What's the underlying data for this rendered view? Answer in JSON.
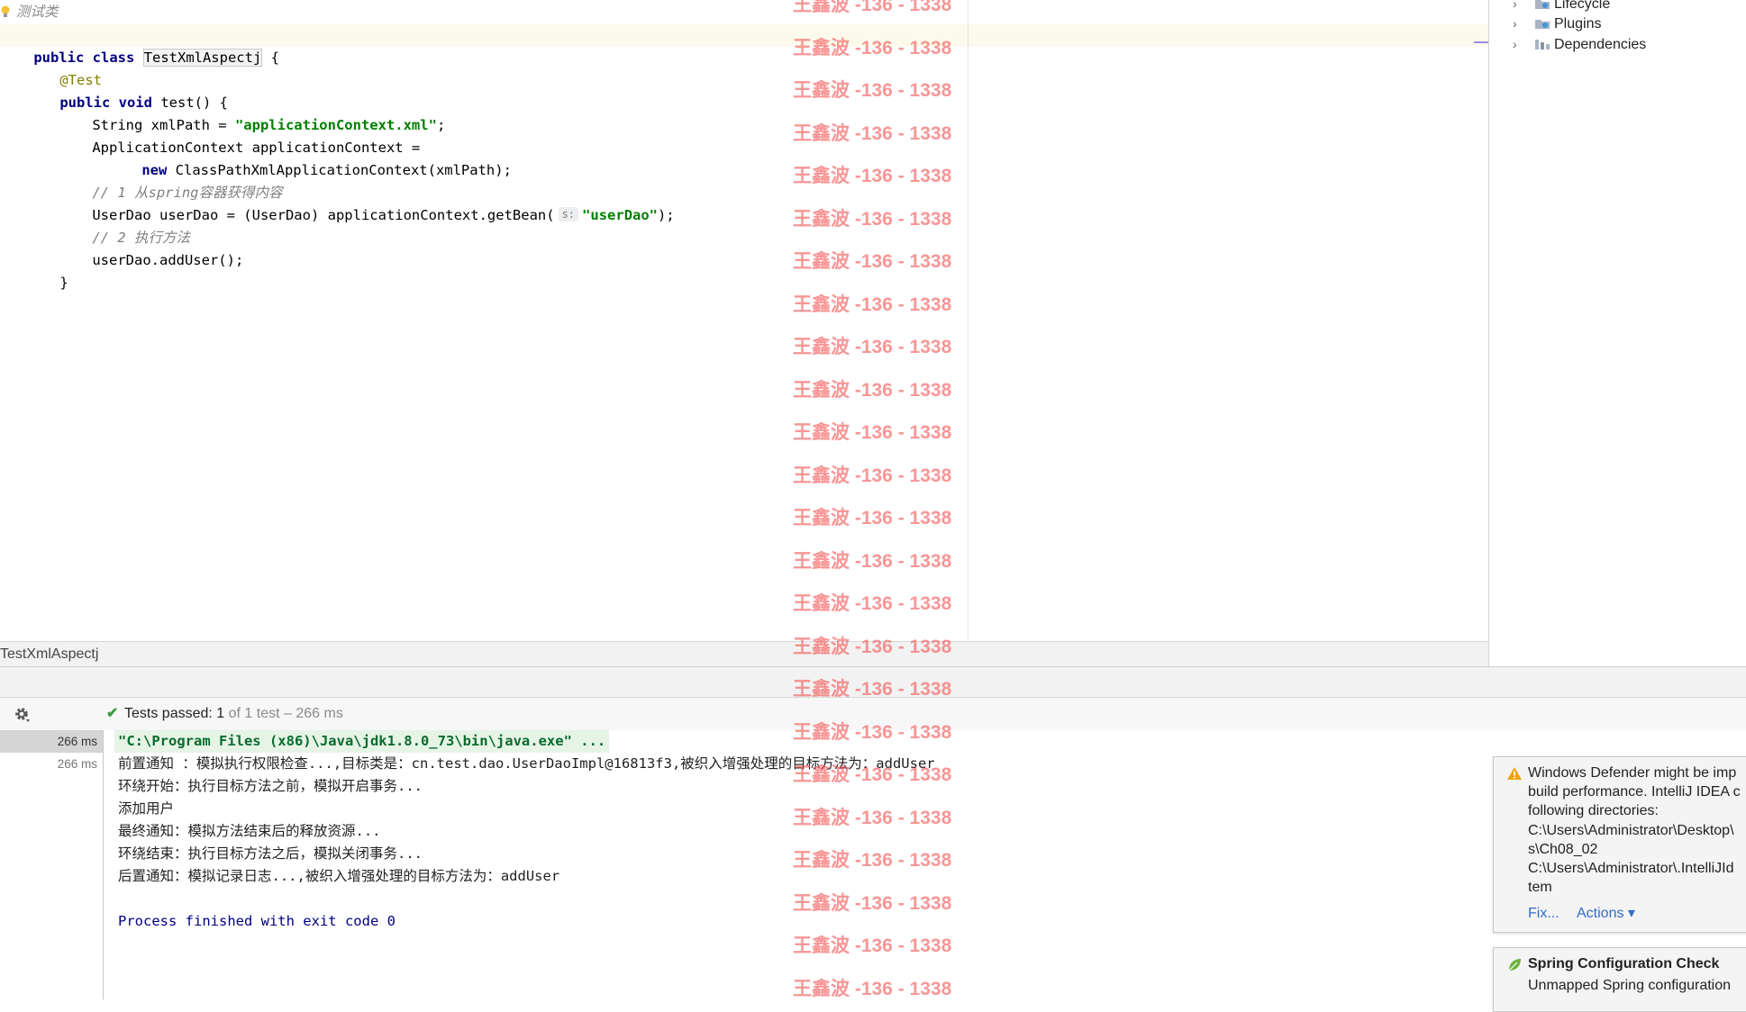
{
  "editor": {
    "doc_comment": "测试类",
    "lines": [
      {
        "kind": "class",
        "kw1": "public ",
        "kw2": "class ",
        "name": "TestXmlAspectj",
        "rest": " {"
      },
      {
        "kind": "annotation",
        "text": "@Test"
      },
      {
        "kind": "method",
        "kw1": "public ",
        "kw2": "void ",
        "rest": "test() {"
      },
      {
        "kind": "str",
        "pre": "String xmlPath = ",
        "str": "\"applicationContext.xml\"",
        "post": ";"
      },
      {
        "kind": "plain",
        "text": "ApplicationContext applicationContext ="
      },
      {
        "kind": "new",
        "kw": "new ",
        "rest": "ClassPathXmlApplicationContext(xmlPath);"
      },
      {
        "kind": "comment",
        "text": "// 1 从spring容器获得内容"
      },
      {
        "kind": "getbean",
        "pre": "UserDao userDao = (UserDao) applicationContext.getBean(",
        "hint": "s:",
        "str": "\"userDao\"",
        "post": ");"
      },
      {
        "kind": "comment",
        "text": "// 2 执行方法"
      },
      {
        "kind": "plain",
        "text": "userDao.addUser();"
      },
      {
        "kind": "plain",
        "text": "}"
      }
    ]
  },
  "breadcrumb": {
    "label": "TestXmlAspectj"
  },
  "maven": {
    "items": [
      {
        "label": "Lifecycle",
        "icon": "lifecycle-folder-icon"
      },
      {
        "label": "Plugins",
        "icon": "plugins-folder-icon"
      },
      {
        "label": "Dependencies",
        "icon": "dependencies-icon"
      }
    ]
  },
  "run": {
    "status_label": "Tests passed: ",
    "status_count": "1",
    "status_rest": " of 1 test – 266 ms",
    "durations": [
      "266 ms",
      "266 ms"
    ],
    "console": [
      "\"C:\\Program Files (x86)\\Java\\jdk1.8.0_73\\bin\\java.exe\" ...",
      "前置通知 ：模拟执行权限检查...,目标类是：cn.test.dao.UserDaoImpl@16813f3,被织入增强处理的目标方法为：addUser",
      "环绕开始：执行目标方法之前，模拟开启事务...",
      "添加用户",
      "最终通知：模拟方法结束后的释放资源...",
      "环绕结束：执行目标方法之后，模拟关闭事务...",
      "后置通知：模拟记录日志...,被织入增强处理的目标方法为：addUser",
      "",
      "Process finished with exit code 0"
    ]
  },
  "notifications": [
    {
      "icon": "warning-icon",
      "lines": [
        "Windows Defender might be imp",
        "build performance. IntelliJ IDEA c",
        "following directories:",
        "C:\\Users\\Administrator\\Desktop\\",
        "s\\Ch08_02",
        "C:\\Users\\Administrator\\.IntelliJId",
        "tem"
      ],
      "actions": [
        "Fix...",
        "Actions ▾"
      ]
    },
    {
      "icon": "spring-leaf-icon",
      "title": "Spring Configuration Check",
      "lines": [
        "Unmapped Spring configuration"
      ]
    }
  ],
  "watermark": {
    "text": "王鑫波 -136 - 1338"
  },
  "colors": {
    "keyword": "#000080",
    "string": "#008000",
    "comment": "#808080",
    "watermark": "#f55555",
    "link": "#2f6fc7"
  }
}
